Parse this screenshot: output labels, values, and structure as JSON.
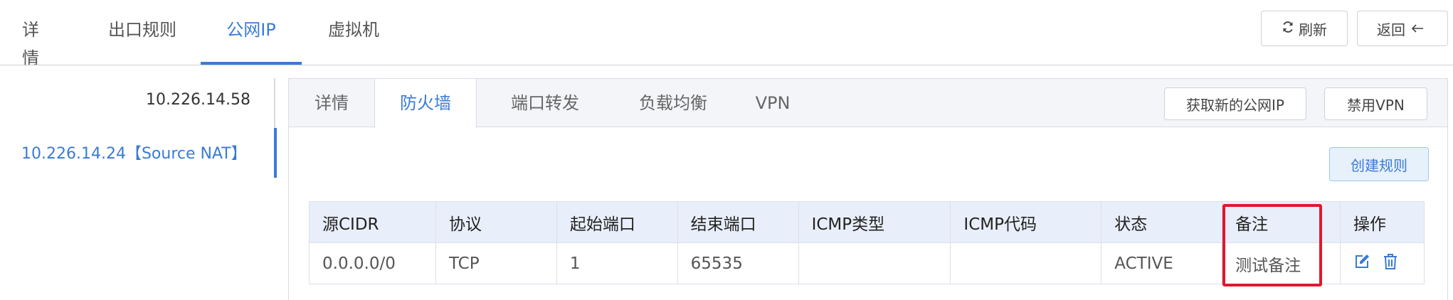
{
  "top_tabs": [
    "详情",
    "出口规则",
    "公网IP",
    "虚拟机"
  ],
  "top_active_tab": "公网IP",
  "header_buttons": {
    "refresh": "刷新",
    "back": "返回"
  },
  "ip_list": [
    "10.226.14.58",
    "10.226.14.24【Source NAT】"
  ],
  "selected_ip": "10.226.14.24【Source NAT】",
  "inner_tabs": [
    "详情",
    "防火墙",
    "端口转发",
    "负载均衡",
    "VPN"
  ],
  "inner_active_tab": "防火墙",
  "panel_buttons": {
    "acquire_ip": "获取新的公网IP",
    "disable_vpn": "禁用VPN",
    "create_rule": "创建规则"
  },
  "table": {
    "headers": [
      "源CIDR",
      "协议",
      "起始端口",
      "结束端口",
      "ICMP类型",
      "ICMP代码",
      "状态",
      "备注",
      "操作"
    ],
    "rows": [
      {
        "cidr": "0.0.0.0/0",
        "protocol": "TCP",
        "start_port": "1",
        "end_port": "65535",
        "icmp_type": "",
        "icmp_code": "",
        "status": "ACTIVE",
        "remark": "测试备注"
      }
    ]
  },
  "colors": {
    "accent": "#3a7bd5",
    "highlight": "#e0182d",
    "header_bg": "#e9effa"
  },
  "icons": {
    "refresh": "refresh-icon",
    "back": "arrow-left-icon",
    "edit": "edit-icon",
    "delete": "trash-icon"
  }
}
